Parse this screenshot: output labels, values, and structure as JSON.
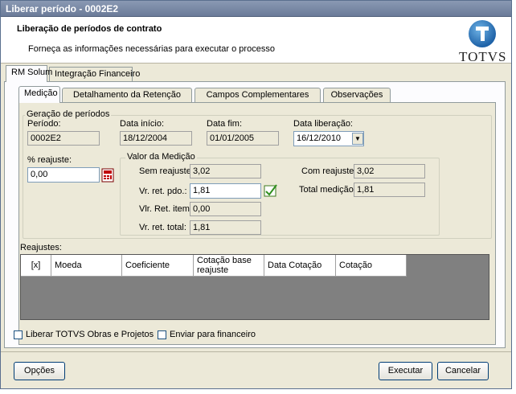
{
  "window": {
    "title": "Liberar período - 0002E2"
  },
  "header": {
    "title": "Liberação de períodos de contrato",
    "description": "Forneça as informações necessárias para executar o processo",
    "logo_text": "TOTVS"
  },
  "outer_tabs": [
    "RM Solum",
    "Integração Financeiro"
  ],
  "inner_tabs": [
    "Medição",
    "Detalhamento da Retenção",
    "Campos Complementares",
    "Observações"
  ],
  "geracao": {
    "group_label": "Geração de períodos",
    "periodo_label": "Período:",
    "periodo_value": "0002E2",
    "data_inicio_label": "Data início:",
    "data_inicio_value": "18/12/2004",
    "data_fim_label": "Data fim:",
    "data_fim_value": "01/01/2005",
    "data_liberacao_label": "Data liberação:",
    "data_liberacao_value": "16/12/2010",
    "reajuste_label": "% reajuste:",
    "reajuste_value": "0,00"
  },
  "medicao": {
    "group_label": "Valor da Medição",
    "sem_reajuste_label": "Sem reajuste:",
    "sem_reajuste_value": "3,02",
    "vr_ret_pdo_label": "Vr. ret. pdo.:",
    "vr_ret_pdo_value": "1,81",
    "vlr_ret_item_label": "Vlr. Ret. item:",
    "vlr_ret_item_value": "0,00",
    "vr_ret_total_label": "Vr. ret. total:",
    "vr_ret_total_value": "1,81",
    "com_reajuste_label": "Com reajuste:",
    "com_reajuste_value": "3,02",
    "total_medicao_label": "Total medição:",
    "total_medicao_value": "1,81"
  },
  "reajustes": {
    "group_label": "Reajustes:",
    "columns": [
      "[x]",
      "Moeda",
      "Coeficiente",
      "Cotação base reajuste",
      "Data Cotação",
      "Cotação"
    ]
  },
  "checkboxes": {
    "liberar_label": "Liberar TOTVS Obras e Projetos",
    "enviar_label": "Enviar para financeiro"
  },
  "buttons": {
    "opcoes": "Opções",
    "executar": "Executar",
    "cancelar": "Cancelar"
  }
}
